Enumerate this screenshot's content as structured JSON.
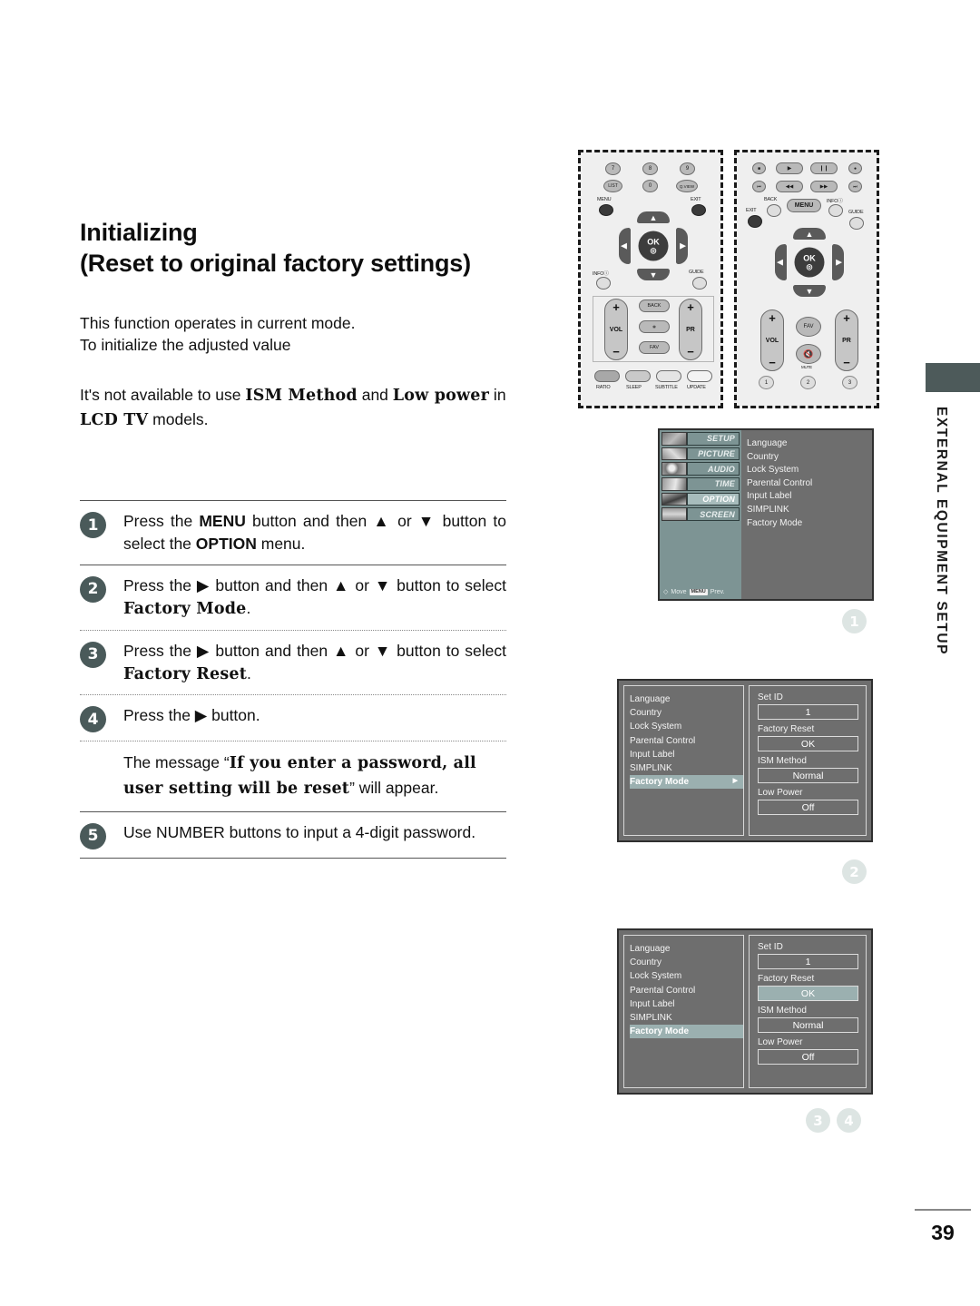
{
  "document": {
    "title": "Initializing",
    "subtitle": "(Reset to original factory settings)",
    "intro_line1": "This function operates in current mode.",
    "intro_line2": "To initialize the adjusted value",
    "note_prefix": "It's not available to use ",
    "note_bold1": "ISM Method",
    "note_mid": " and ",
    "note_bold2": "Low power",
    "note_suffix": " in ",
    "note_bold3": "LCD TV",
    "note_end": " models.",
    "page_number": "39",
    "side_tab_label": "EXTERNAL EQUIPMENT SETUP"
  },
  "steps": [
    {
      "number": "1",
      "text_parts": [
        "Press the ",
        "MENU",
        " button and then ▲ or ▼ button to select the ",
        "OPTION",
        " menu."
      ]
    },
    {
      "number": "2",
      "text_parts": [
        "Press the ▶ button and then ▲ or ▼ button to select ",
        "Factory Mode",
        "."
      ]
    },
    {
      "number": "3",
      "text_parts": [
        "Press the ▶ button and then ▲ or ▼ button to select ",
        "Factory Reset",
        "."
      ]
    },
    {
      "number": "4",
      "text_parts": [
        "Press the ▶ button."
      ]
    },
    {
      "number": "5",
      "text_parts": [
        "Use NUMBER buttons to input a 4-digit password."
      ]
    }
  ],
  "message_note": {
    "prefix": "The message “",
    "bold": "If you enter a password, all user setting will be reset",
    "suffix": "” will appear."
  },
  "remote_left": {
    "row1": [
      "7",
      "8",
      "9"
    ],
    "row2": [
      "LIST",
      "0",
      "Q.VIEW"
    ],
    "menu_label": "MENU",
    "exit_label": "EXIT",
    "info_label": "INFO",
    "guide_label": "GUIDE",
    "ok_label": "OK",
    "vol_label": "VOL",
    "pr_label": "PR",
    "back_label": "BACK",
    "star_label": "∗",
    "fav_label": "FAV",
    "bottom_keys": [
      "RATIO",
      "SLEEP",
      "SUBTITLE",
      "UPDATE"
    ]
  },
  "remote_right": {
    "transport_row1": [
      "■",
      "▶",
      "❙❙",
      "●"
    ],
    "transport_row2": [
      "⏮",
      "◀◀",
      "▶▶",
      "⏭"
    ],
    "back_label": "BACK",
    "menu_label": "MENU",
    "info_label": "INFO",
    "exit_label": "EXIT",
    "guide_label": "GUIDE",
    "ok_label": "OK",
    "vol_label": "VOL",
    "pr_label": "PR",
    "fav_label": "FAV",
    "mute_label": "MUTE",
    "number_row": [
      "1",
      "2",
      "3"
    ]
  },
  "osd_main": {
    "nav_items": [
      {
        "label": "SETUP",
        "selected": false
      },
      {
        "label": "PICTURE",
        "selected": false
      },
      {
        "label": "AUDIO",
        "selected": false
      },
      {
        "label": "TIME",
        "selected": false
      },
      {
        "label": "OPTION",
        "selected": true
      },
      {
        "label": "SCREEN",
        "selected": false
      }
    ],
    "menu_items": [
      "Language",
      "Country",
      "Lock System",
      "Parental Control",
      "Input Label",
      "SIMPLINK",
      "Factory Mode"
    ],
    "hint_move": "Move",
    "hint_menu_key": "MENU",
    "hint_prev": "Prev."
  },
  "osd_step2": {
    "left_items": [
      "Language",
      "Country",
      "Lock System",
      "Parental Control",
      "Input Label",
      "SIMPLINK",
      "Factory Mode"
    ],
    "highlighted_index": 6,
    "highlight_arrow": "▶",
    "fields": [
      {
        "label": "Set ID",
        "value": "1",
        "highlighted": false
      },
      {
        "label": "Factory Reset",
        "value": "OK",
        "highlighted": false
      },
      {
        "label": "ISM Method",
        "value": "Normal",
        "highlighted": false
      },
      {
        "label": "Low Power",
        "value": "Off",
        "highlighted": false
      }
    ]
  },
  "osd_step34": {
    "left_items": [
      "Language",
      "Country",
      "Lock System",
      "Parental Control",
      "Input Label",
      "SIMPLINK",
      "Factory Mode"
    ],
    "highlighted_index": 6,
    "fields": [
      {
        "label": "Set ID",
        "value": "1",
        "highlighted": false
      },
      {
        "label": "Factory Reset",
        "value": "OK",
        "highlighted": true
      },
      {
        "label": "ISM Method",
        "value": "Normal",
        "highlighted": false
      },
      {
        "label": "Low Power",
        "value": "Off",
        "highlighted": false
      }
    ]
  },
  "markers": {
    "m1": "1",
    "m2": "2",
    "m3": "3",
    "m4": "4"
  },
  "colors": {
    "badge": "#4a5a5a",
    "marker": "#dde5e3",
    "osd_bg": "#6e6e6e",
    "osd_nav": "#7d9494",
    "osd_highlight": "#9bb0b0",
    "side_tab": "#4d5a5a"
  }
}
